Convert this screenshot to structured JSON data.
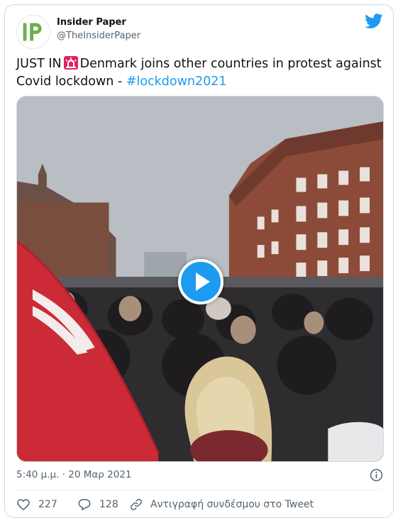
{
  "author": {
    "display_name": "Insider Paper",
    "handle": "@TheInsiderPaper",
    "avatar_icon": "insider-paper-logo"
  },
  "platform_icon": "twitter-bird-icon",
  "tweet": {
    "text_before": "JUST IN",
    "emoji_icon": "siren-emoji-icon",
    "text_after": "Denmark joins other countries in protest against Covid lockdown - ",
    "hashtag": "#lockdown2021"
  },
  "media": {
    "type": "video",
    "play_icon": "play-icon"
  },
  "timestamp": {
    "time": "5:40 μ.μ.",
    "separator": "·",
    "date": "20 Μαρ 2021"
  },
  "actions": {
    "likes": "227",
    "replies": "128",
    "copy_link_label": "Αντιγραφή συνδέσμου στο Tweet"
  },
  "colors": {
    "accent": "#1d9bf0",
    "text": "#0f1419",
    "secondary_text": "#536471",
    "border": "#cfd9de"
  }
}
